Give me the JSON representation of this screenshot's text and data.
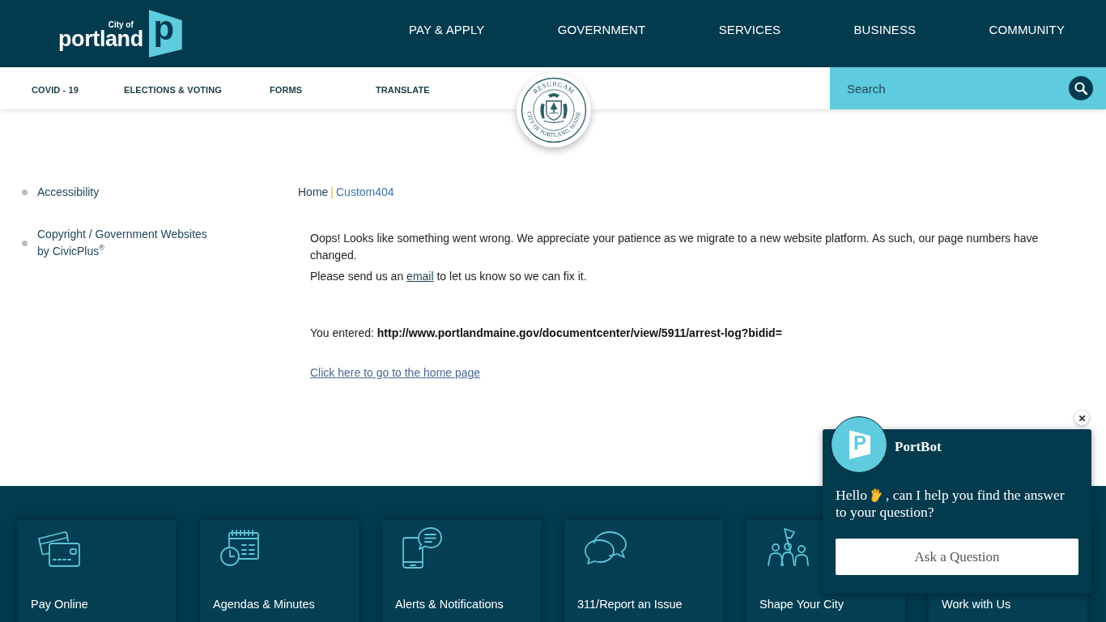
{
  "header": {
    "logo": {
      "small_text": "City of",
      "name": "portland",
      "mark_letter": "p"
    },
    "nav": [
      {
        "label": "PAY & APPLY"
      },
      {
        "label": "GOVERNMENT"
      },
      {
        "label": "SERVICES"
      },
      {
        "label": "BUSINESS"
      },
      {
        "label": "COMMUNITY"
      }
    ]
  },
  "quick_links": [
    {
      "label": "COVID - 19"
    },
    {
      "label": "ELECTIONS & VOTING"
    },
    {
      "label": "FORMS"
    },
    {
      "label": "TRANSLATE"
    }
  ],
  "search": {
    "placeholder": "Search"
  },
  "seal": {
    "motto": "RESURGAM",
    "legend": "CITY OF PORTLAND, MAINE"
  },
  "sidebar": {
    "items": [
      {
        "text": "Accessibility"
      },
      {
        "text": "Copyright / Government Websites by CivicPlus$^{®}$"
      }
    ]
  },
  "breadcrumb": {
    "items": [
      {
        "label": "Home"
      },
      {
        "label": "Custom404"
      }
    ],
    "separator": "|"
  },
  "message": {
    "intro": "Oops! Looks like something went wrong. We appreciate your patience as we migrate to a new website platform. As such, our page numbers have changed.",
    "contact": {
      "before": "Please send us an ",
      "link": "email",
      "after": " to let us know so we can fix it."
    },
    "entered": "You entered: **http://www.portlandmaine.gov/documentcenter/view/5911/arrest-log?bidid=**",
    "home_link": "Click here to go to the home page"
  },
  "footer_tiles": [
    {
      "label": "Pay Online"
    },
    {
      "label": "Agendas & Minutes"
    },
    {
      "label": "Alerts & Notifications"
    },
    {
      "label": "311/Report an Issue"
    },
    {
      "label": "Shape Your City"
    },
    {
      "label": "Work with Us"
    }
  ],
  "chatbot": {
    "name": "PortBot",
    "avatar_letter": "P",
    "greeting": {
      "lead": "Hello",
      "line_1_rest": ", can I help you find the answer",
      "line_2": "to your question?"
    },
    "button": "Ask a Question"
  }
}
